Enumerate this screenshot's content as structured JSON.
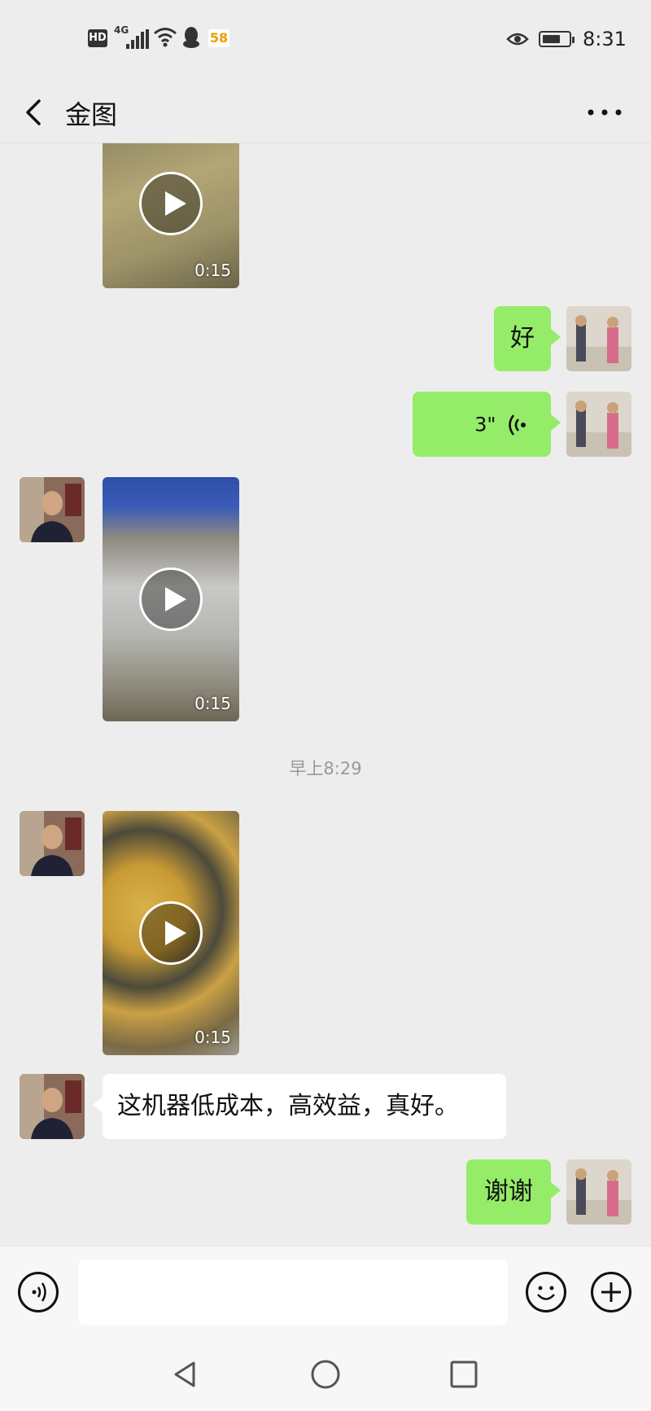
{
  "status_bar": {
    "hd_label": "HD",
    "network_label": "4G",
    "badge_58": "58",
    "time": "8:31",
    "battery_level": 0.7
  },
  "header": {
    "title": "金图"
  },
  "messages": {
    "video_1_duration": "0:15",
    "outgoing_text_1": "好",
    "voice_duration": "3\"",
    "video_2_duration": "0:15",
    "timestamp": "早上8:29",
    "video_3_duration": "0:15",
    "incoming_text_1": "这机器低成本，高效益，真好。",
    "outgoing_text_2": "谢谢"
  },
  "input_bar": {
    "placeholder": ""
  },
  "colors": {
    "background": "#ededed",
    "outgoing_bubble": "#95ec69",
    "incoming_bubble": "#ffffff",
    "timestamp_text": "#9a9a9a"
  }
}
